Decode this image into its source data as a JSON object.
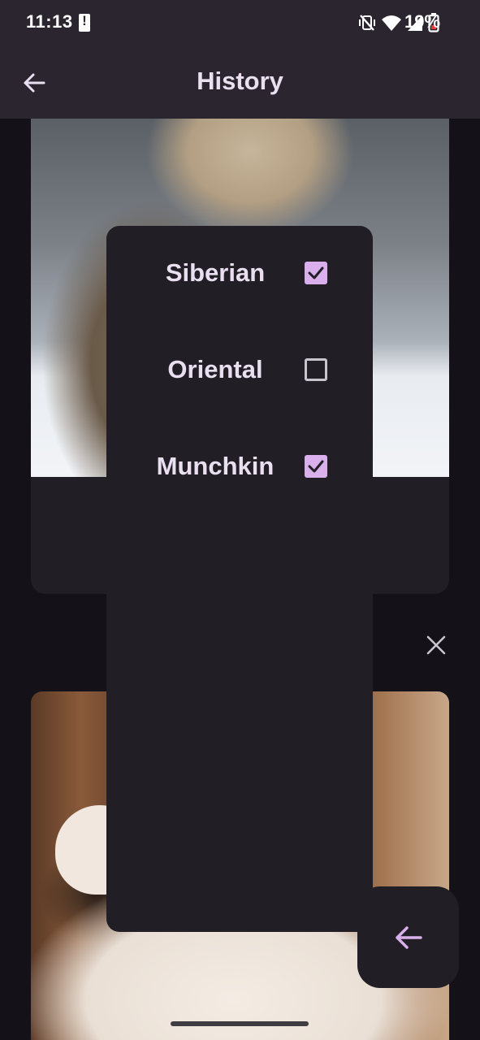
{
  "status_bar": {
    "time": "11:13",
    "battery_percent": "19%",
    "icons": [
      "notification-alert-icon",
      "vibrate-off-icon",
      "wifi-icon",
      "cellular-signal-icon",
      "battery-low-icon"
    ]
  },
  "app_bar": {
    "title": "History",
    "back_icon": "arrow-back-icon"
  },
  "dropdown": {
    "options": [
      {
        "label": "Siberian",
        "checked": true
      },
      {
        "label": "Oriental",
        "checked": false
      },
      {
        "label": "Munchkin",
        "checked": true
      }
    ]
  },
  "card": {
    "close_icon": "close-icon"
  },
  "fab": {
    "icon": "arrow-back-icon"
  },
  "colors": {
    "app_bar_bg": "#2b2530",
    "surface": "#211e25",
    "accent": "#d9b0ec",
    "text": "#e9dff0"
  }
}
